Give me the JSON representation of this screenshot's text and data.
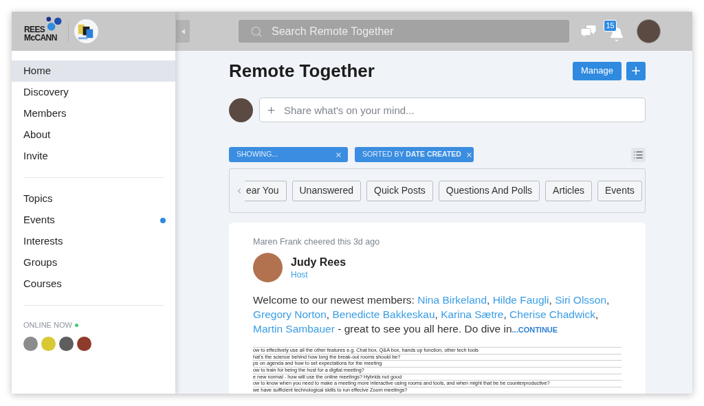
{
  "header": {
    "logo": {
      "line_1": "REES",
      "line_2": "McCANN"
    },
    "search": {
      "placeholder": "Search Remote Together"
    },
    "notifications": {
      "count": "15"
    }
  },
  "sidebar": {
    "nav_groups": [
      {
        "items": [
          {
            "label": "Home",
            "selected": true,
            "unread": false
          },
          {
            "label": "Discovery",
            "selected": false,
            "unread": false
          },
          {
            "label": "Members",
            "selected": false,
            "unread": false
          },
          {
            "label": "About",
            "selected": false,
            "unread": false
          },
          {
            "label": "Invite",
            "selected": false,
            "unread": false
          }
        ]
      },
      {
        "items": [
          {
            "label": "Topics",
            "selected": false,
            "unread": false
          },
          {
            "label": "Events",
            "selected": false,
            "unread": true
          },
          {
            "label": "Interests",
            "selected": false,
            "unread": false
          },
          {
            "label": "Groups",
            "selected": false,
            "unread": false
          },
          {
            "label": "Courses",
            "selected": false,
            "unread": false
          }
        ]
      }
    ],
    "online_now": {
      "label": "ONLINE NOW",
      "members": [
        {
          "color": "#8c8c8c"
        },
        {
          "color": "#d8c834"
        },
        {
          "color": "#5e5e5e"
        },
        {
          "color": "#8e3b2c"
        }
      ]
    }
  },
  "page": {
    "title": "Remote Together",
    "buttons": [
      {
        "kind": "text",
        "label": "Manage"
      },
      {
        "kind": "add"
      }
    ]
  },
  "composer": {
    "placeholder": "Share what's on your mind..."
  },
  "filters": [
    {
      "label": "SHOWING..."
    },
    {
      "label": "SORTED BY **DATE CREATED**"
    }
  ],
  "post_types": [
    {
      "label": "ear You",
      "selected": false
    },
    {
      "label": "Unanswered",
      "selected": false
    },
    {
      "label": "Quick Posts",
      "selected": false
    },
    {
      "label": "Questions And Polls",
      "selected": false
    },
    {
      "label": "Articles",
      "selected": false
    },
    {
      "label": "Events",
      "selected": false
    }
  ],
  "post": {
    "activity": "Maren Frank cheered this 3d ago",
    "author": "Judy Rees",
    "role": "Host",
    "body": [
      {
        "kind": "text",
        "text": "Welcome to our newest members: "
      },
      {
        "kind": "link",
        "text": "Nina Birkeland"
      },
      {
        "kind": "text",
        "text": ", "
      },
      {
        "kind": "link",
        "text": "Hilde Faugli"
      },
      {
        "kind": "text",
        "text": ", "
      },
      {
        "kind": "link",
        "text": "Siri Olsson"
      },
      {
        "kind": "text",
        "text": ", "
      },
      {
        "kind": "link",
        "text": "Gregory Norton"
      },
      {
        "kind": "text",
        "text": ", "
      },
      {
        "kind": "link",
        "text": "Benedicte Bakkeskau"
      },
      {
        "kind": "text",
        "text": ", "
      },
      {
        "kind": "link",
        "text": "Karina Sætre"
      },
      {
        "kind": "text",
        "text": ", "
      },
      {
        "kind": "link",
        "text": "Cherise Chadwick"
      },
      {
        "kind": "text",
        "text": ", "
      },
      {
        "kind": "link",
        "text": "Martin Sambauer"
      },
      {
        "kind": "text",
        "text": " - great to see you all here. Do dive in"
      }
    ],
    "continue": "...CONTINUE",
    "attachment": {
      "rows": [
        "ow to effectively use all the other features e.g. Chat box, Q&A box, hands up function, other tech tools",
        "hat's the science behind how long the break-out rooms should be?",
        "ps on agenda and how to set expectations for the meeting",
        "ow to train for being the host for a digital meeting?",
        "e new normal - how will use the online meetings? Hybrids not good",
        "ow to know when you need to make a meeting more interactive using rooms and tools, and when might that be be counterproductive?",
        "we have sufficient technological skills to run effecive Zoom meetings?"
      ]
    }
  }
}
